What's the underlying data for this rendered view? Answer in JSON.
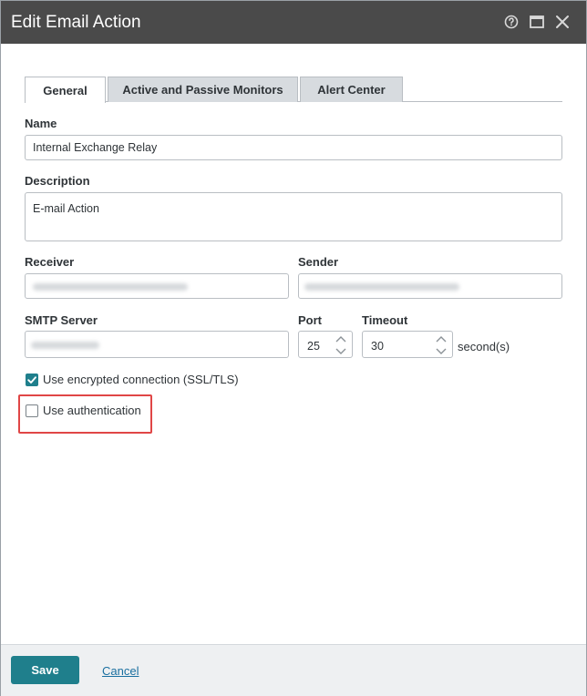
{
  "dialog": {
    "title": "Edit Email Action",
    "icons": [
      "help-icon",
      "maximize-icon",
      "close-icon"
    ]
  },
  "tabs": [
    {
      "label": "General",
      "active": true
    },
    {
      "label": "Active and Passive Monitors",
      "active": false
    },
    {
      "label": "Alert Center",
      "active": false
    }
  ],
  "form": {
    "name_label": "Name",
    "name_value": "Internal Exchange Relay",
    "description_label": "Description",
    "description_value": "E-mail Action",
    "receiver_label": "Receiver",
    "sender_label": "Sender",
    "smtp_label": "SMTP Server",
    "port_label": "Port",
    "port_value": "25",
    "timeout_label": "Timeout",
    "timeout_value": "30",
    "timeout_unit": "second(s)",
    "ssl_label": "Use encrypted connection (SSL/TLS)",
    "ssl_checked": true,
    "auth_label": "Use authentication",
    "auth_checked": false
  },
  "footer": {
    "save_label": "Save",
    "cancel_label": "Cancel"
  },
  "colors": {
    "accent": "#1f7f8c",
    "titlebar": "#4a4a4a",
    "highlight": "#e04646",
    "link": "#1a6fa0"
  }
}
